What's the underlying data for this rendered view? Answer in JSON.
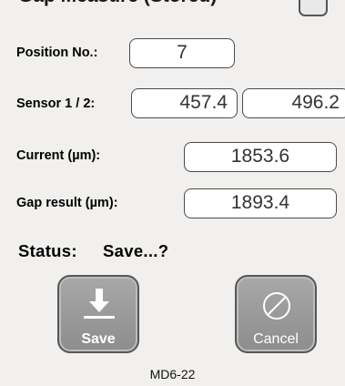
{
  "header": {
    "title": "Gap Measure (Stored)"
  },
  "form": {
    "position_label": "Position No.:",
    "position_value": "7",
    "sensor_label": "Sensor 1 / 2:",
    "sensor1_value": "457.4",
    "sensor2_value": "496.2",
    "current_label": "Current (µm):",
    "current_value": "1853.6",
    "gap_label": "Gap result (µm):",
    "gap_value": "1893.4"
  },
  "status": {
    "label": "Status:",
    "value": "Save...?"
  },
  "buttons": {
    "save": {
      "label": "Save",
      "icon": "download-arrow-icon"
    },
    "cancel": {
      "label": "Cancel",
      "icon": "no-entry-icon"
    }
  },
  "footer": {
    "text": "MD6-22"
  },
  "colors": {
    "button_bg": "#999999",
    "field_border": "#4a4a4a",
    "background": "#f1f0ee"
  }
}
